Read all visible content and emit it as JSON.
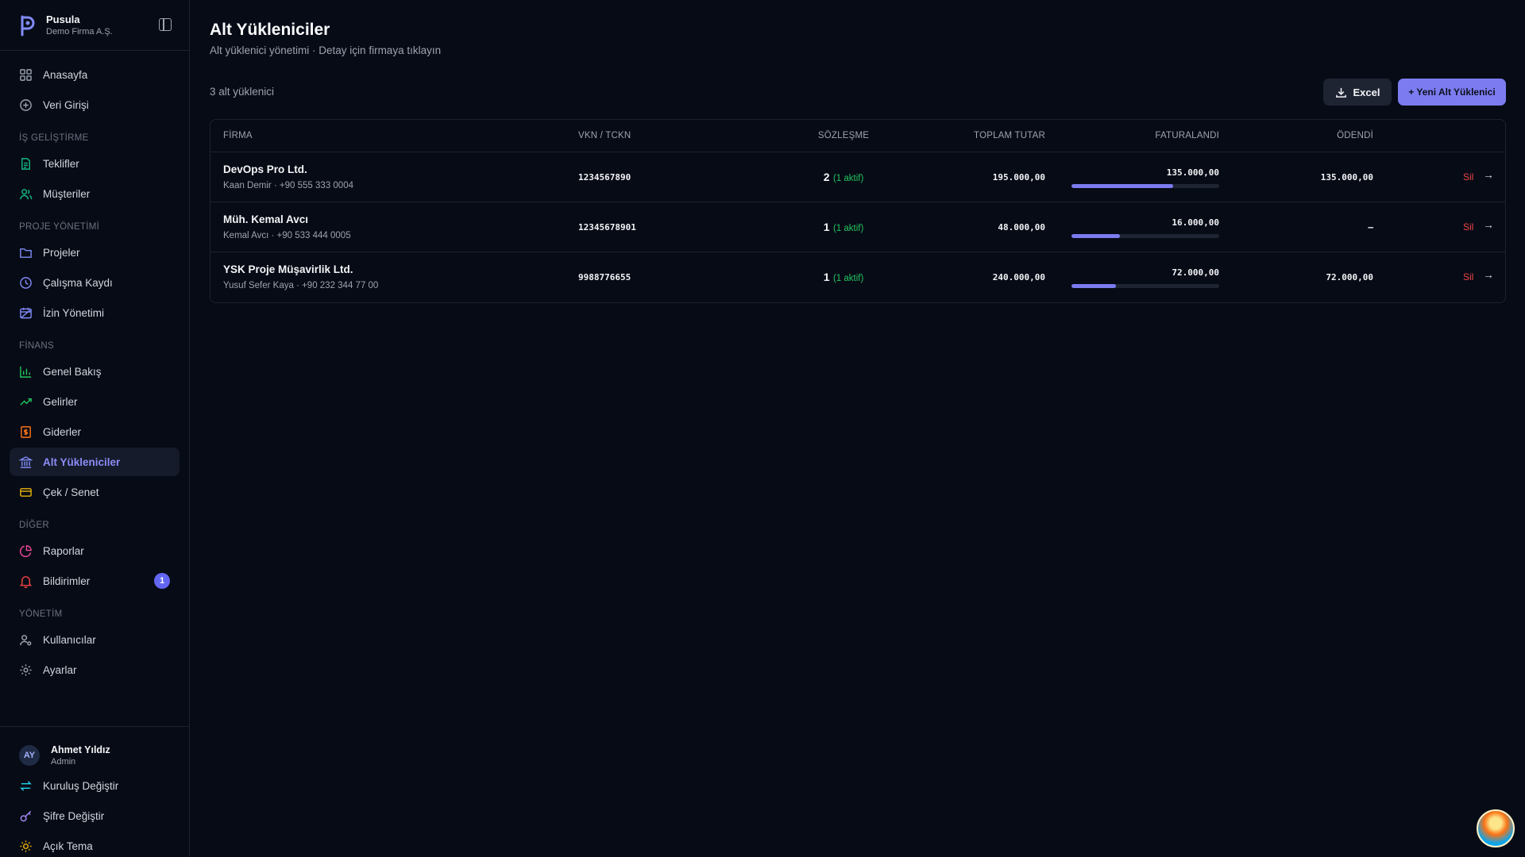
{
  "brand": {
    "name": "Pusula",
    "org": "Demo Firma A.Ş."
  },
  "nav": {
    "top": [
      {
        "label": "Anasayfa",
        "icon": "grid-icon"
      },
      {
        "label": "Veri Girişi",
        "icon": "plus-circle-icon"
      }
    ],
    "sections": [
      {
        "title": "İŞ GELİŞTİRME",
        "items": [
          {
            "label": "Teklifler",
            "icon": "document-icon"
          },
          {
            "label": "Müşteriler",
            "icon": "users-icon"
          }
        ]
      },
      {
        "title": "PROJE YÖNETİMİ",
        "items": [
          {
            "label": "Projeler",
            "icon": "folder-icon"
          },
          {
            "label": "Çalışma Kaydı",
            "icon": "clock-icon"
          },
          {
            "label": "İzin Yönetimi",
            "icon": "calendar-off-icon"
          }
        ]
      },
      {
        "title": "FİNANS",
        "items": [
          {
            "label": "Genel Bakış",
            "icon": "bar-chart-icon"
          },
          {
            "label": "Gelirler",
            "icon": "trending-up-icon"
          },
          {
            "label": "Giderler",
            "icon": "receipt-icon"
          },
          {
            "label": "Alt Yükleniciler",
            "icon": "bank-icon"
          },
          {
            "label": "Çek / Senet",
            "icon": "card-icon"
          }
        ]
      },
      {
        "title": "DİĞER",
        "items": [
          {
            "label": "Raporlar",
            "icon": "pie-chart-icon"
          },
          {
            "label": "Bildirimler",
            "icon": "bell-icon",
            "badge": "1"
          }
        ]
      },
      {
        "title": "YÖNETİM",
        "items": [
          {
            "label": "Kullanıcılar",
            "icon": "user-gear-icon"
          },
          {
            "label": "Ayarlar",
            "icon": "gear-icon"
          }
        ]
      }
    ]
  },
  "user": {
    "initials": "AY",
    "name": "Ahmet Yıldız",
    "role": "Admin",
    "actions": [
      {
        "label": "Kuruluş Değiştir",
        "icon": "swap-icon"
      },
      {
        "label": "Şifre Değiştir",
        "icon": "key-icon"
      },
      {
        "label": "Açık Tema",
        "icon": "sun-icon"
      }
    ]
  },
  "page": {
    "title": "Alt Yükleniciler",
    "subtitle": "Alt yüklenici yönetimi · Detay için firmaya tıklayın",
    "count_label": "3 alt yüklenici",
    "excel_label": "Excel",
    "new_label": "+ Yeni Alt Yüklenici"
  },
  "table": {
    "headers": {
      "firm": "FİRMA",
      "vkn": "VKN / TCKN",
      "contract": "SÖZLEŞME",
      "total": "TOPLAM TUTAR",
      "invoiced": "FATURALANDI",
      "paid": "ÖDENDİ"
    },
    "rows": [
      {
        "name": "DevOps Pro Ltd.",
        "contact": "Kaan Demir · +90 555 333 0004",
        "vkn": "1234567890",
        "contracts": "2",
        "active": "(1 aktif)",
        "total": "195.000,00",
        "invoiced": "135.000,00",
        "invoiced_ratio": 0.69,
        "paid": "135.000,00",
        "delete": "Sil",
        "arrow": "→"
      },
      {
        "name": "Müh. Kemal Avcı",
        "contact": "Kemal Avcı · +90 533 444 0005",
        "vkn": "12345678901",
        "contracts": "1",
        "active": "(1 aktif)",
        "total": "48.000,00",
        "invoiced": "16.000,00",
        "invoiced_ratio": 0.33,
        "paid": "–",
        "delete": "Sil",
        "arrow": "→"
      },
      {
        "name": "YSK Proje Müşavirlik Ltd.",
        "contact": "Yusuf Sefer Kaya · +90 232 344 77 00",
        "vkn": "9988776655",
        "contracts": "1",
        "active": "(1 aktif)",
        "total": "240.000,00",
        "invoiced": "72.000,00",
        "invoiced_ratio": 0.3,
        "paid": "72.000,00",
        "delete": "Sil",
        "arrow": "→"
      }
    ]
  },
  "colors": {
    "accent": "#7c7cf0",
    "success": "#22c55e",
    "danger": "#ef4444",
    "background": "#070b16"
  }
}
